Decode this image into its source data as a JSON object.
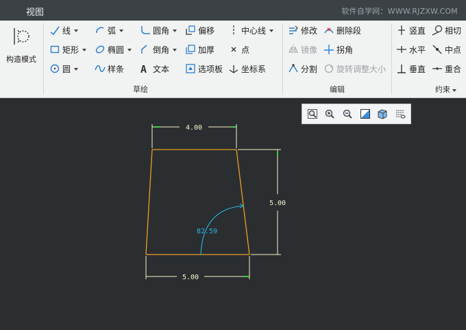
{
  "title_bar": {
    "tab_label": "视图",
    "watermark": "软件自学网：WWW.RJZXW.COM"
  },
  "ribbon": {
    "construct_mode_label": "构造模式",
    "sketch": {
      "group_label": "草绘",
      "items": [
        {
          "label": "线",
          "icon": "line-icon"
        },
        {
          "label": "弧",
          "icon": "arc-icon"
        },
        {
          "label": "圆角",
          "icon": "fillet-icon"
        },
        {
          "label": "偏移",
          "icon": "offset-icon"
        },
        {
          "label": "中心线",
          "icon": "centerline-icon"
        },
        {
          "label": "矩形",
          "icon": "rectangle-icon"
        },
        {
          "label": "椭圆",
          "icon": "ellipse-icon"
        },
        {
          "label": "倒角",
          "icon": "chamfer-icon"
        },
        {
          "label": "加厚",
          "icon": "thicken-icon"
        },
        {
          "label": "点",
          "icon": "point-icon"
        },
        {
          "label": "圆",
          "icon": "circle-icon"
        },
        {
          "label": "样条",
          "icon": "spline-icon"
        },
        {
          "label": "文本",
          "icon": "text-icon"
        },
        {
          "label": "选项板",
          "icon": "palette-icon"
        },
        {
          "label": "坐标系",
          "icon": "coordinate-system-icon"
        }
      ]
    },
    "edit": {
      "group_label": "编辑",
      "items": [
        {
          "label": "修改",
          "icon": "modify-icon"
        },
        {
          "label": "删除段",
          "icon": "delete-segment-icon"
        },
        {
          "label": "镜像",
          "icon": "mirror-icon"
        },
        {
          "label": "拐角",
          "icon": "corner-icon"
        },
        {
          "label": "分割",
          "icon": "divide-icon"
        },
        {
          "label": "旋转调整大小",
          "icon": "rotate-resize-icon"
        }
      ]
    },
    "constrain": {
      "group_label": "约束",
      "items": [
        {
          "label": "竖直",
          "icon": "vertical-icon"
        },
        {
          "label": "相切",
          "icon": "tangent-icon"
        },
        {
          "label": "水平",
          "icon": "horizontal-icon"
        },
        {
          "label": "中点",
          "icon": "midpoint-icon"
        },
        {
          "label": "垂直",
          "icon": "perpendicular-icon"
        },
        {
          "label": "重合",
          "icon": "coincident-icon"
        }
      ]
    }
  },
  "view_toolbar": {
    "buttons": [
      "refit-icon",
      "zoom-in-icon",
      "zoom-out-icon",
      "repaint-icon",
      "display-style-icon",
      "sketcher-display-icon"
    ]
  },
  "sketch": {
    "dim_top": "4.00",
    "dim_right": "5.00",
    "dim_bottom": "5.00",
    "dim_angle": "82.59"
  },
  "colors": {
    "canvas_bg": "#2b2e30",
    "geometry": "#e8a02a",
    "dimension": "#f4f4c8",
    "angle_dimension": "#25b7e6",
    "constraint_marker": "#39d33c"
  }
}
